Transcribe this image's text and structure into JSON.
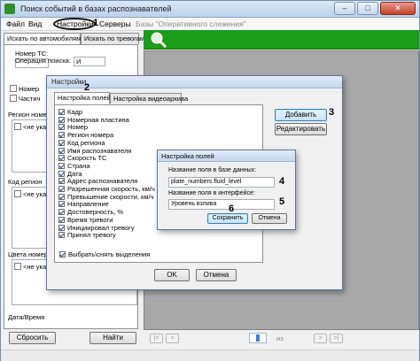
{
  "window": {
    "title": "Поиск событий в базах распознавателей",
    "min_glyph": "–",
    "max_glyph": "□",
    "close_glyph": "✕"
  },
  "menubar": {
    "file": "Файл",
    "view": "Вид",
    "settings": "Настройки",
    "servers": "Серверы",
    "database": "Базы \"Оперативного слежения\""
  },
  "annotations": {
    "m1": "1",
    "m2": "2",
    "m3": "3",
    "m4": "4",
    "m5": "5",
    "m6": "6"
  },
  "left_panel": {
    "tab_vehicles": "Искать по автомобилям",
    "tab_alarms": "Искать по тревогам",
    "plate_label": "Номер ТС:",
    "search_op_label": "Операция поиска:",
    "search_op_value": "И",
    "cb1_label": "Номер",
    "cb2_label": "Частич",
    "region_group": "Регион номер",
    "region_item": "<не указ",
    "code_group": "Код регион",
    "code_item": "<не указ",
    "color_group": "Цвета номер",
    "color_item": "<не указ",
    "datetime_label": "Дата/Время",
    "reset_button": "Сбросить",
    "find_button": "Найти"
  },
  "bottom_nav": {
    "first": "|<",
    "prev": "<",
    "next": ">",
    "last": ">|",
    "of_text": "из"
  },
  "settings_dialog": {
    "title": "Настройки",
    "tab_fields": "Настройка полей",
    "tab_video": "Настройка видеоархива",
    "fields": [
      "Кадр",
      "Номерная пластина",
      "Номер",
      "Регион номера",
      "Код региона",
      "Имя распознавателя",
      "Скорость ТС",
      "Страна",
      "Дата",
      "Адрес распознавателя",
      "Разрешенная скорость, км/ч",
      "Превышение скорости, км/ч",
      "Направление",
      "Достоверность, %",
      "Время тревоги",
      "Инициировал тревогу",
      "Принял тревогу"
    ],
    "select_all": "Выбрать\\снять выделения",
    "add_button": "Добавить",
    "edit_button": "Редактировать",
    "ok_button": "OK",
    "cancel_button": "Отмена"
  },
  "field_dialog": {
    "title": "Настройка полей",
    "db_name_label": "Название поля в базе данных:",
    "db_name_value": "plate_numbers.fluid_level",
    "ui_name_label": "Название поля в интерфейсе:",
    "ui_name_value": "Уровень взлива",
    "save_button": "Сохранить",
    "cancel_button": "Отмена"
  }
}
